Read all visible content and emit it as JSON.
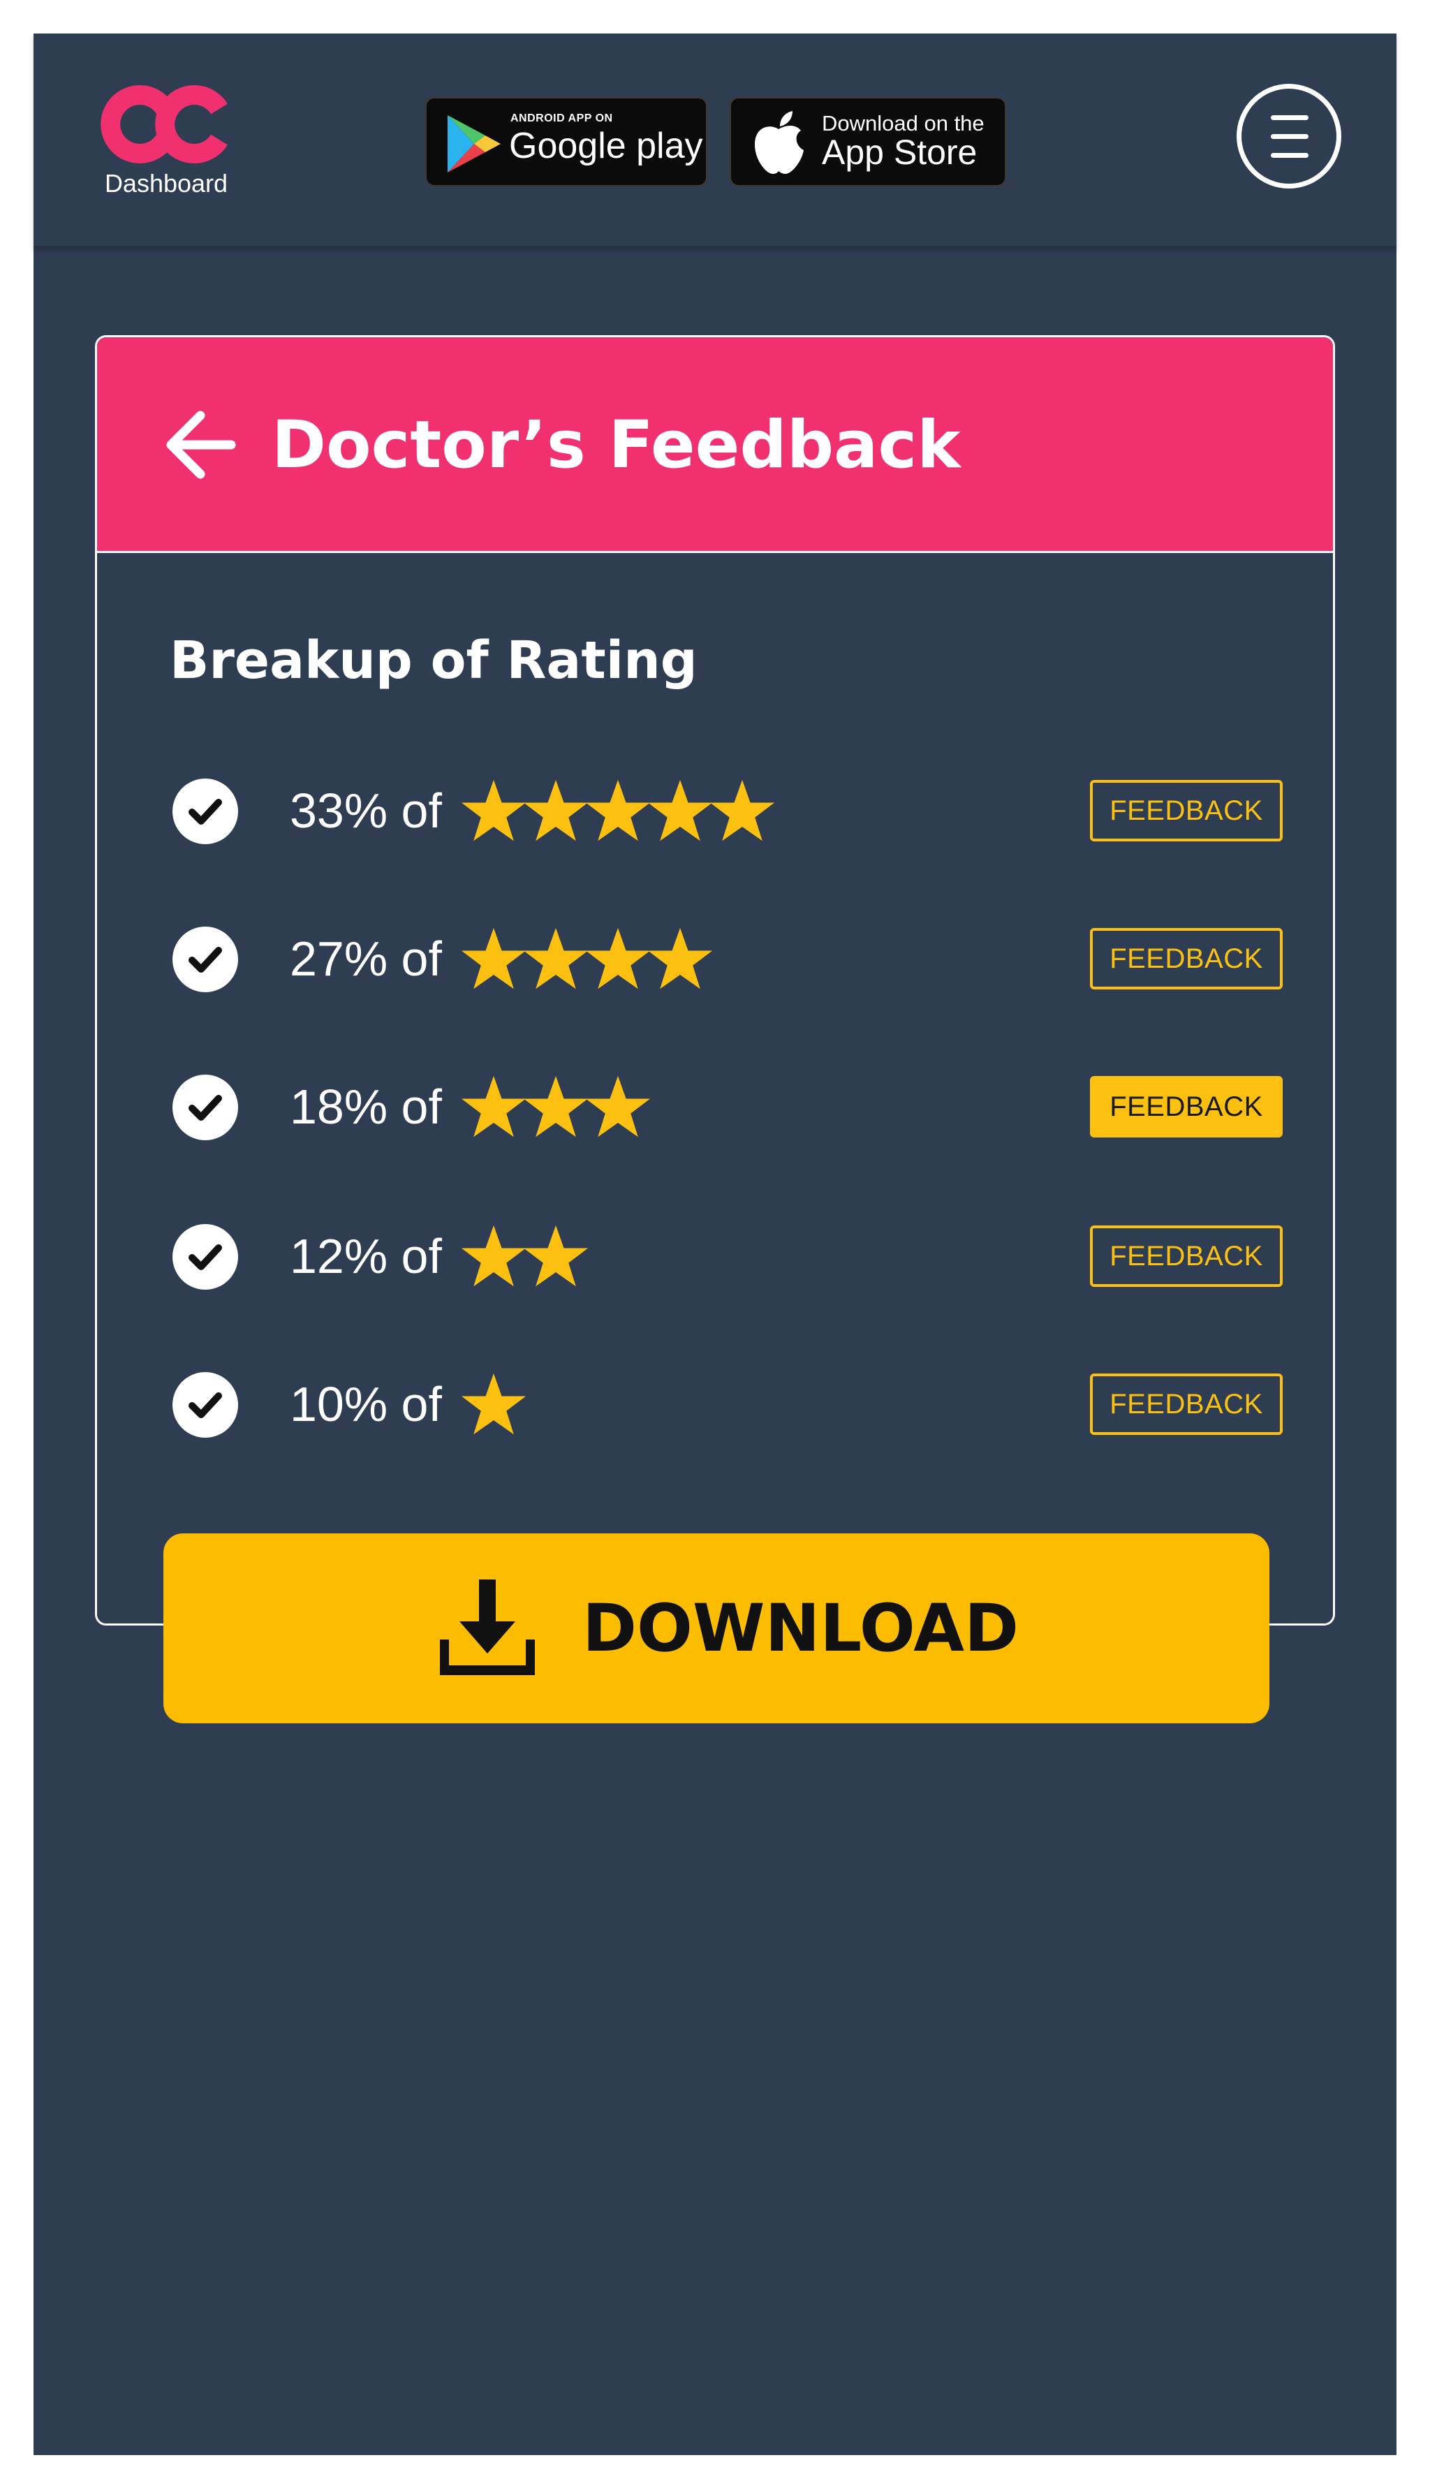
{
  "header": {
    "logo_label": "Dashboard",
    "google_play": {
      "small": "ANDROID APP ON",
      "big": "Google play"
    },
    "app_store": {
      "small": "Download on the",
      "big": "App Store"
    },
    "menu_icon": "hamburger-menu-icon"
  },
  "card": {
    "title": "Doctor’s Feedback",
    "back_icon": "arrow-left-icon",
    "breakup_title": "Breakup of Rating",
    "ratings": [
      {
        "percent_text": "33% of",
        "stars": 5,
        "feedback_label": "FEEDBACK",
        "active": false
      },
      {
        "percent_text": "27% of",
        "stars": 4,
        "feedback_label": "FEEDBACK",
        "active": false
      },
      {
        "percent_text": "18% of",
        "stars": 3,
        "feedback_label": "FEEDBACK",
        "active": true
      },
      {
        "percent_text": "12% of",
        "stars": 2,
        "feedback_label": "FEEDBACK",
        "active": false
      },
      {
        "percent_text": "10% of",
        "stars": 1,
        "feedback_label": "FEEDBACK",
        "active": false
      }
    ]
  },
  "download": {
    "label": "DOWNLOAD",
    "icon": "download-icon"
  },
  "colors": {
    "background": "#2e3d51",
    "accent_pink": "#f0306f",
    "accent_yellow": "#fcc010",
    "star": "#fcc010"
  }
}
